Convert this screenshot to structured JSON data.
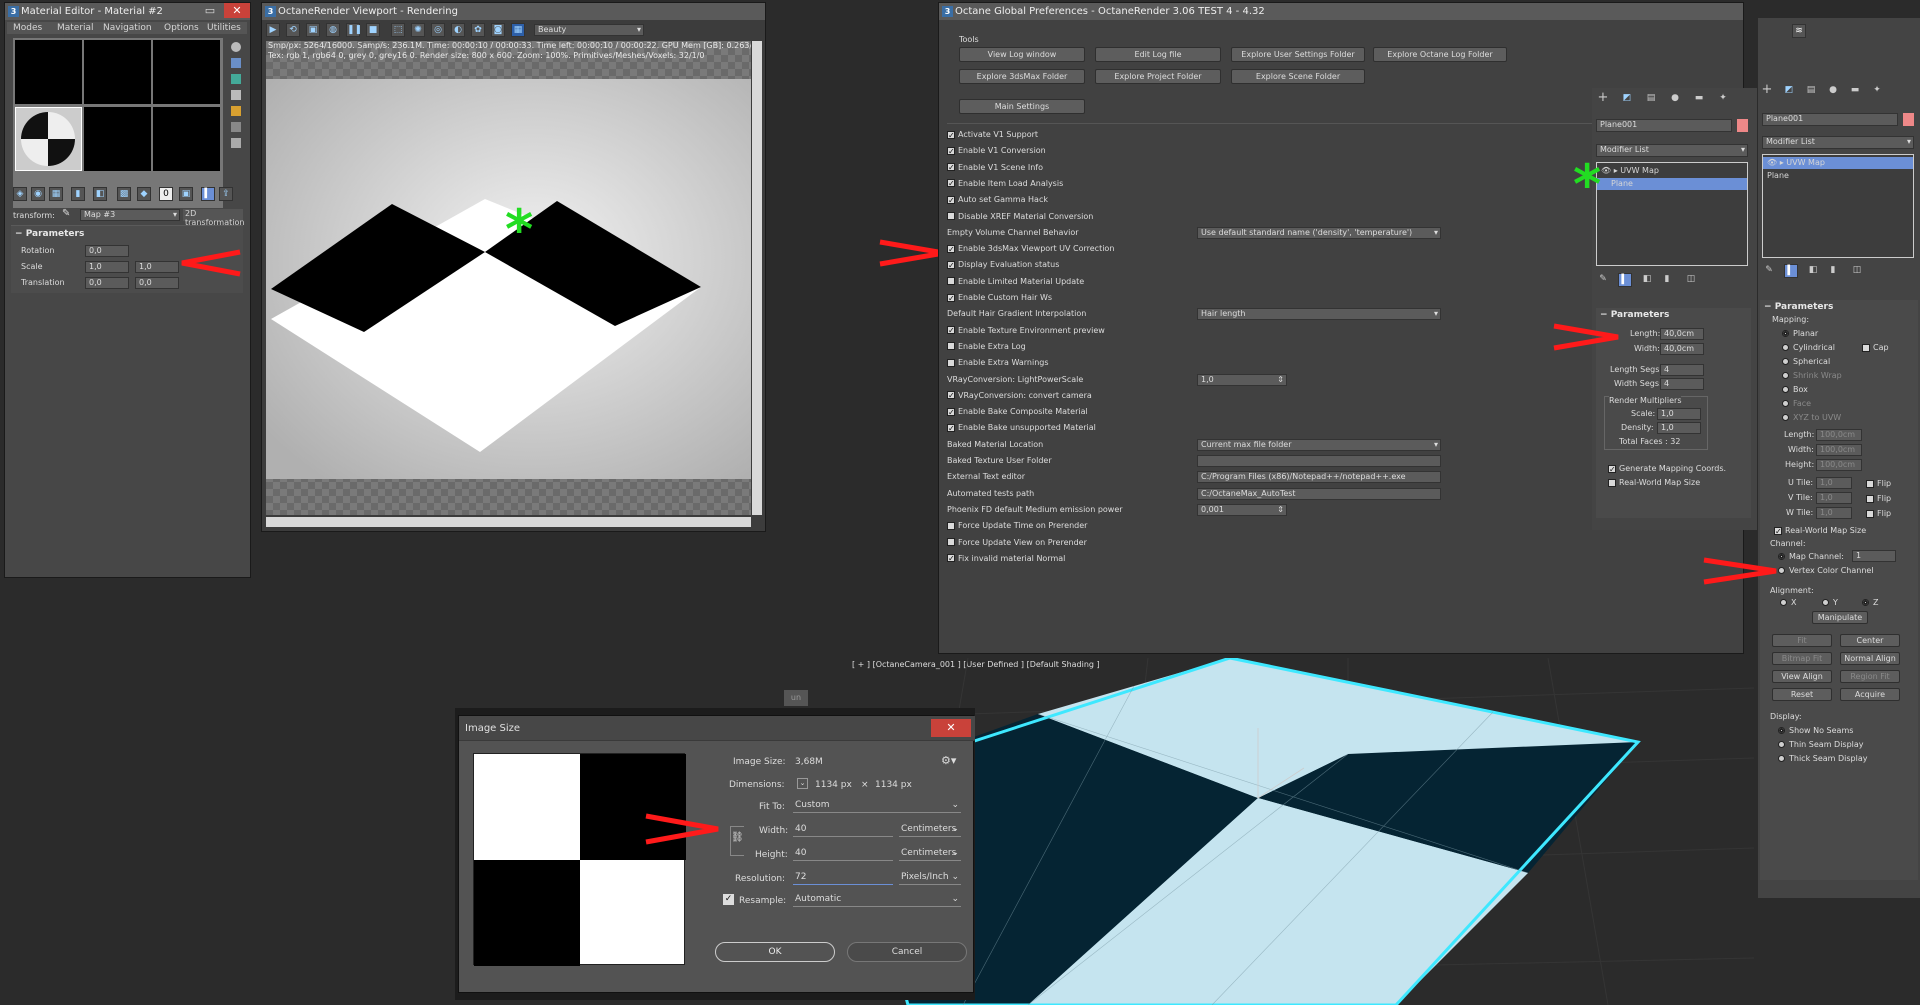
{
  "colors": {
    "accent_blue": "#6b8fd6",
    "arrow_red": "#ff1a1a",
    "star_green": "#22dd22",
    "viewport_cyan": "#3ee8ff",
    "tile_light": "#c5e4ef",
    "tile_dark": "#052433"
  },
  "material_editor": {
    "title": "Material Editor - Material #2",
    "menu": [
      "Modes",
      "Material",
      "Navigation",
      "Options",
      "Utilities"
    ],
    "transform_label": "transform:",
    "map_name": "Map #3",
    "map_type": "2D transformation",
    "section": "Parameters",
    "rows": [
      {
        "label": "Rotation",
        "v1": "0,0",
        "v2": ""
      },
      {
        "label": "Scale",
        "v1": "1,0",
        "v2": "1,0"
      },
      {
        "label": "Translation",
        "v1": "0,0",
        "v2": "0,0"
      }
    ]
  },
  "octane_viewport": {
    "title": "OctaneRender Viewport - Rendering",
    "pass": "Beauty",
    "stats1": "Smp/px: 5264/16000.   Samp/s: 236.1M.   Time: 00:00:10 / 00:00:33.   Time left: 00:00:10 / 00:00:22.   GPU Mem [GB]: 0.263/11.34",
    "stats2": "Tex: rgb 1, rgb64 0, grey 0, grey16 0.   Render size: 800 x 600.   Zoom: 100%.   Primitives/Meshes/Voxels: 32/1/0"
  },
  "prefs": {
    "title": "Octane Global Preferences - OctaneRender 3.06 TEST 4 - 4.32",
    "tools_label": "Tools",
    "tool_buttons": [
      "View Log window",
      "Edit Log file",
      "Explore User Settings Folder",
      "Explore Octane Log Folder",
      "Explore 3dsMax Folder",
      "Explore Project Folder",
      "Explore Scene Folder"
    ],
    "main_settings": "Main Settings",
    "rows": [
      {
        "t": "cb",
        "label": "Activate V1 Support",
        "on": true
      },
      {
        "t": "cb",
        "label": "Enable V1 Conversion",
        "on": true
      },
      {
        "t": "cb",
        "label": "Enable V1 Scene Info",
        "on": true
      },
      {
        "t": "cb",
        "label": "Enable Item Load Analysis",
        "on": true
      },
      {
        "t": "cb",
        "label": "Auto set Gamma Hack",
        "on": true
      },
      {
        "t": "cb",
        "label": "Disable XREF Material Conversion",
        "on": false
      },
      {
        "t": "sel",
        "label": "Empty Volume Channel Behavior",
        "value": "Use default standard name ('density', 'temperature')"
      },
      {
        "t": "cb",
        "label": "Enable 3dsMax Viewport UV Correction",
        "on": true
      },
      {
        "t": "cb",
        "label": "Display Evaluation status",
        "on": true
      },
      {
        "t": "cb",
        "label": "Enable Limited Material Update",
        "on": false
      },
      {
        "t": "cb",
        "label": "Enable Custom Hair Ws",
        "on": true
      },
      {
        "t": "sel",
        "label": "Default Hair Gradient Interpolation",
        "value": "Hair length"
      },
      {
        "t": "cb",
        "label": "Enable Texture Environment preview",
        "on": true
      },
      {
        "t": "cb",
        "label": "Enable Extra Log",
        "on": false
      },
      {
        "t": "cb",
        "label": "Enable Extra Warnings",
        "on": false
      },
      {
        "t": "num",
        "label": "VRayConversion: LightPowerScale",
        "value": "1,0"
      },
      {
        "t": "cb",
        "label": "VRayConversion: convert camera",
        "on": true
      },
      {
        "t": "cb",
        "label": "Enable Bake Composite Material",
        "on": true
      },
      {
        "t": "cb",
        "label": "Enable Bake unsupported Material",
        "on": true
      },
      {
        "t": "sel",
        "label": "Baked Material Location",
        "value": "Current max file folder"
      },
      {
        "t": "txt",
        "label": "Baked Texture User Folder",
        "value": ""
      },
      {
        "t": "txt",
        "label": "External Text editor",
        "value": "C:/Program Files (x86)/Notepad++/notepad++.exe"
      },
      {
        "t": "txt",
        "label": "Automated tests path",
        "value": "C:/OctaneMax_AutoTest"
      },
      {
        "t": "num",
        "label": "Phoenix FD default Medium emission power",
        "value": "0,001"
      },
      {
        "t": "cb",
        "label": "Force Update Time on Prerender",
        "on": false
      },
      {
        "t": "cb",
        "label": "Force Update View on Prerender",
        "on": false
      },
      {
        "t": "cb",
        "label": "Fix invalid material Normal",
        "on": true
      }
    ]
  },
  "modify_panel": {
    "object": "Plane001",
    "modifier_list": "Modifier List",
    "stack": [
      "UVW Map",
      "Plane"
    ],
    "section": "Parameters",
    "length_label": "Length:",
    "length": "40,0cm",
    "width_label": "Width:",
    "width": "40,0cm",
    "lsegs_label": "Length Segs:",
    "lsegs": "4",
    "wsegs_label": "Width Segs:",
    "wsegs": "4",
    "render_mult": "Render Multipliers",
    "scale_label": "Scale:",
    "scale": "1,0",
    "density_label": "Density:",
    "density": "1,0",
    "total_faces": "Total Faces : 32",
    "gen_coords": "Generate Mapping Coords.",
    "real_world": "Real-World Map Size"
  },
  "uvw_panel": {
    "object": "Plane001",
    "modifier_list": "Modifier List",
    "stack": [
      "UVW Map",
      "Plane"
    ],
    "section": "Parameters",
    "mapping_label": "Mapping:",
    "mappings": [
      "Planar",
      "Cylindrical",
      "Spherical",
      "Shrink Wrap",
      "Box",
      "Face",
      "XYZ to UVW"
    ],
    "cap_label": "Cap",
    "length_label": "Length:",
    "length": "100,0cm",
    "width_label": "Width:",
    "width": "100,0cm",
    "height_label": "Height:",
    "height": "100,0cm",
    "utile_label": "U Tile:",
    "utile": "1,0",
    "vtile_label": "V Tile:",
    "vtile": "1,0",
    "wtile_label": "W Tile:",
    "wtile": "1,0",
    "flip": "Flip",
    "real_world": "Real-World Map Size",
    "channel_label": "Channel:",
    "map_channel": "Map Channel:",
    "map_channel_val": "1",
    "vertex_channel": "Vertex Color Channel",
    "alignment": "Alignment:",
    "axes": [
      "X",
      "Y",
      "Z"
    ],
    "manipulate": "Manipulate",
    "fit": "Fit",
    "center": "Center",
    "bitmap_fit": "Bitmap Fit",
    "normal_align": "Normal Align",
    "view_align": "View Align",
    "region_fit": "Region Fit",
    "reset": "Reset",
    "acquire": "Acquire",
    "display_label": "Display:",
    "displays": [
      "Show No Seams",
      "Thin Seam Display",
      "Thick Seam Display"
    ]
  },
  "max_viewport": {
    "label": "[ + ] [OctaneCamera_001 ] [User Defined ] [Default Shading ]"
  },
  "image_size": {
    "title": "Image Size",
    "size_label": "Image Size:",
    "size": "3,68M",
    "dims_label": "Dimensions:",
    "dims_w": "1134 px",
    "dims_x": "×",
    "dims_h": "1134 px",
    "fit_label": "Fit To:",
    "fit": "Custom",
    "width_label": "Width:",
    "width": "40",
    "width_unit": "Centimeters",
    "height_label": "Height:",
    "height": "40",
    "height_unit": "Centimeters",
    "res_label": "Resolution:",
    "res": "72",
    "res_unit": "Pixels/Inch",
    "resample_label": "Resample:",
    "resample": "Automatic",
    "ok": "OK",
    "cancel": "Cancel"
  },
  "misc": {
    "star": "*",
    "vp_button": "un"
  }
}
